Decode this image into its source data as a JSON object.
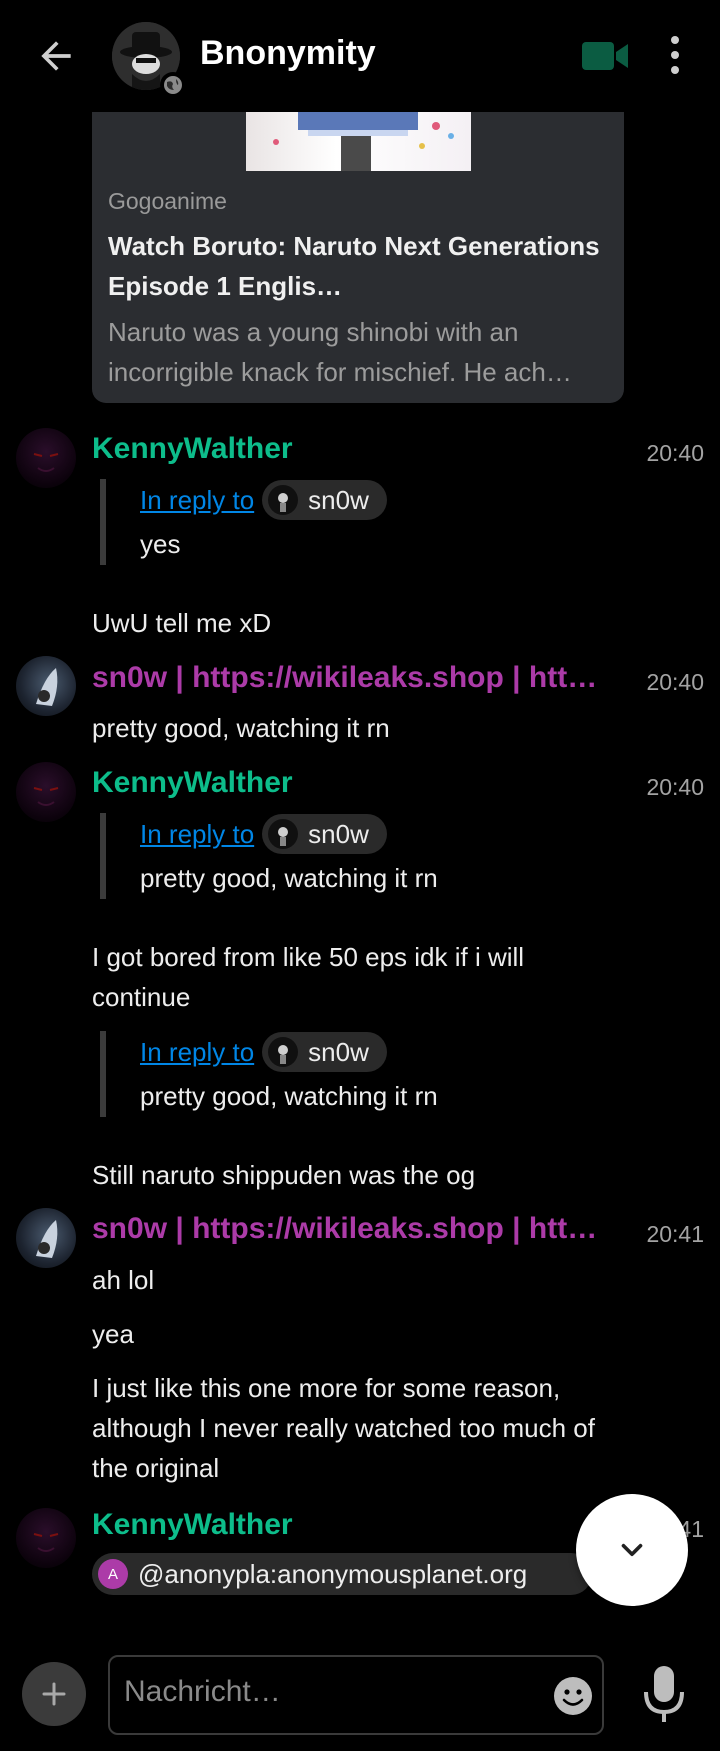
{
  "header": {
    "title": "Bnonymity",
    "accent": "#0dbd8b"
  },
  "preview": {
    "site": "Gogoanime",
    "title": "Watch Boruto: Naruto Next Generations Episode 1 Englis…",
    "description": "Naruto was a young shinobi with an incorrigible knack for mischief. He ach…"
  },
  "messages": [
    {
      "sender": "KennyWalther",
      "time": "20:40",
      "reply_label": "In reply to",
      "reply_user": "sn0w",
      "quoted": "yes",
      "body": "UwU tell me xD"
    },
    {
      "sender": "sn0w | https://wikileaks.shop | http…",
      "time": "20:40",
      "body": "pretty good, watching it rn"
    },
    {
      "sender": "KennyWalther",
      "time": "20:40",
      "reply_label": "In reply to",
      "reply_user": "sn0w",
      "quoted": "pretty good, watching it rn",
      "body": "I got bored from like 50 eps idk if i will continue",
      "reply2_label": "In reply to",
      "reply2_user": "sn0w",
      "quoted2": "pretty good, watching it rn",
      "body2": "Still naruto shippuden was the og"
    },
    {
      "sender": "sn0w | https://wikileaks.shop | http…",
      "time": "20:41",
      "lines": [
        "ah lol",
        "yea",
        "I just like this one more for some reason, although I never really watched too much of the original"
      ]
    },
    {
      "sender": "KennyWalther",
      "time": "20:41",
      "mention_initial": "A",
      "mention": "@anonypla:anonymousplanet.org"
    }
  ],
  "composer": {
    "placeholder": "Nachricht…"
  },
  "colors": {
    "kenny": "#0dbd8b",
    "snow": "#ac3ba8",
    "link": "#0086e6"
  },
  "icons": [
    "back-arrow-icon",
    "globe-icon",
    "video-call-icon",
    "more-vert-icon",
    "chevron-down-icon",
    "plus-icon",
    "emoji-icon",
    "microphone-icon"
  ]
}
